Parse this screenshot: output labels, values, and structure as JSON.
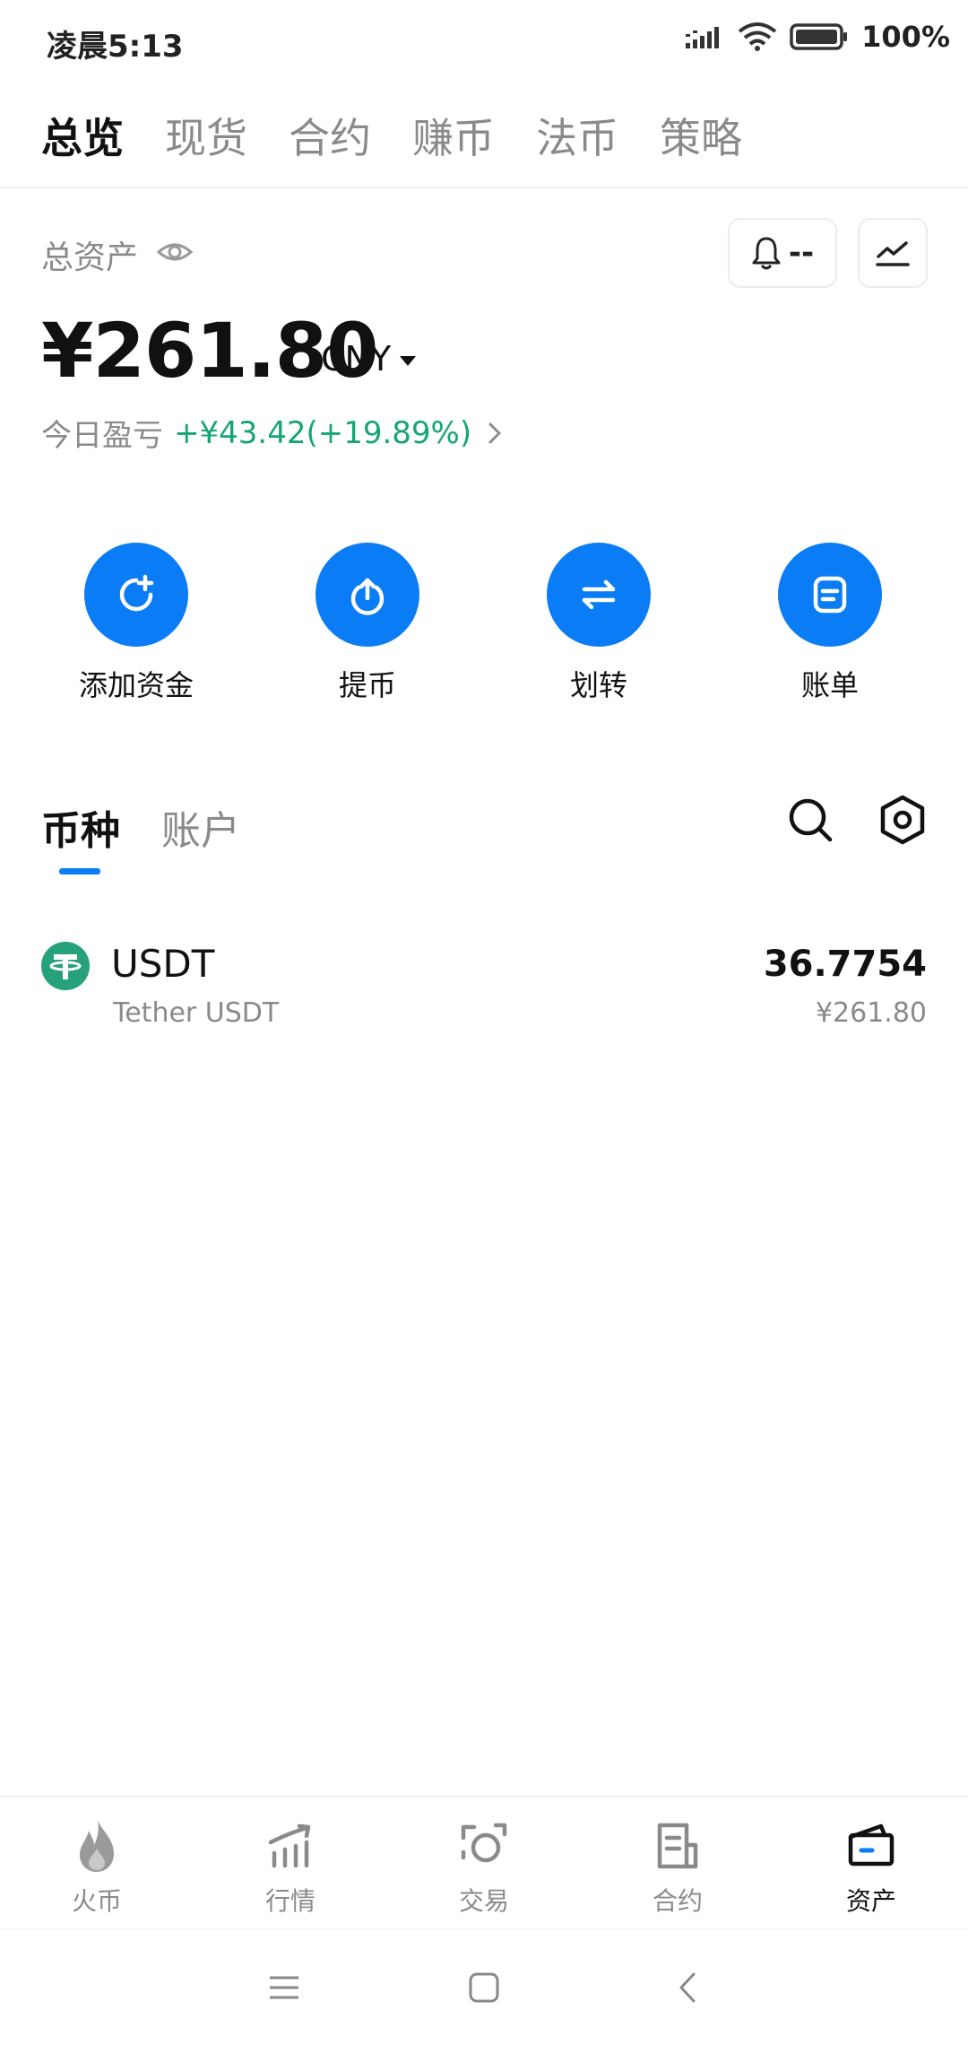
{
  "status_bar": {
    "time": "凌晨5:13",
    "battery": "100%"
  },
  "top_tabs": [
    {
      "label": "总览"
    },
    {
      "label": "现货"
    },
    {
      "label": "合约"
    },
    {
      "label": "赚币"
    },
    {
      "label": "法币"
    },
    {
      "label": "策略"
    }
  ],
  "overview": {
    "assets_label": "总资产",
    "alert_text": "--",
    "total_value": "¥261.80",
    "currency": "CNY",
    "pnl_label": "今日盈亏",
    "pnl_value": "+¥43.42(+19.89%)"
  },
  "actions": [
    {
      "label": "添加资金",
      "icon": "add-funds-icon"
    },
    {
      "label": "提币",
      "icon": "withdraw-icon"
    },
    {
      "label": "划转",
      "icon": "transfer-icon"
    },
    {
      "label": "账单",
      "icon": "bill-icon"
    }
  ],
  "section_tabs": [
    {
      "label": "币种"
    },
    {
      "label": "账户"
    }
  ],
  "assets": [
    {
      "symbol": "USDT",
      "name": "Tether USDT",
      "amount": "36.7754",
      "value": "¥261.80",
      "icon": "tether-icon"
    }
  ],
  "bottom_nav": [
    {
      "label": "火币",
      "icon": "flame-icon"
    },
    {
      "label": "行情",
      "icon": "market-icon"
    },
    {
      "label": "交易",
      "icon": "trade-icon"
    },
    {
      "label": "合约",
      "icon": "contract-icon"
    },
    {
      "label": "资产",
      "icon": "wallet-icon"
    }
  ],
  "colors": {
    "accent": "#0a7cf5",
    "positive": "#17a673",
    "tether": "#26a17b",
    "muted": "#8a8a8a"
  }
}
